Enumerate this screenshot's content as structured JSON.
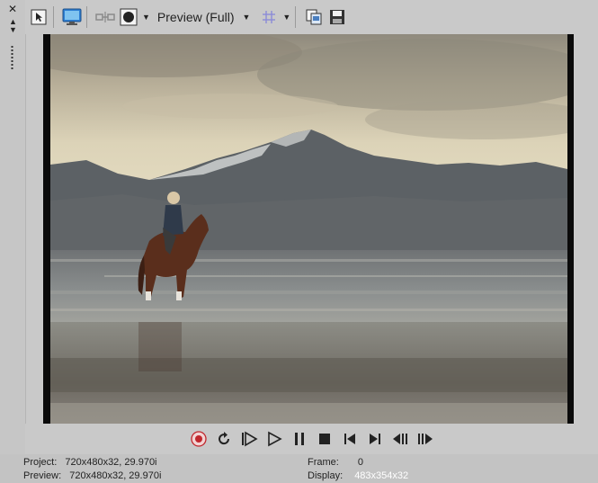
{
  "toolbar": {
    "preview_quality": "Preview (Full)",
    "icons": [
      "cursor-select-icon",
      "monitor-icon",
      "split-screen-icon",
      "overlay-circle-icon",
      "grid-icon",
      "copy-snapshot-icon",
      "save-snapshot-icon"
    ]
  },
  "transport": {
    "icons": [
      "record-icon",
      "loop-icon",
      "play-from-start-icon",
      "play-icon",
      "pause-icon",
      "stop-icon",
      "go-to-start-icon",
      "go-to-end-icon",
      "previous-frame-icon",
      "next-frame-icon"
    ]
  },
  "status": {
    "project_label": "Project:",
    "project_value": "720x480x32, 29.970i",
    "preview_label": "Preview:",
    "preview_value": "720x480x32, 29.970i",
    "frame_label": "Frame:",
    "frame_value": "0",
    "display_label": "Display:",
    "display_value": "483x354x32"
  },
  "colors": {
    "record_red": "#c0272d",
    "accent_blue": "#2d7fd4"
  }
}
